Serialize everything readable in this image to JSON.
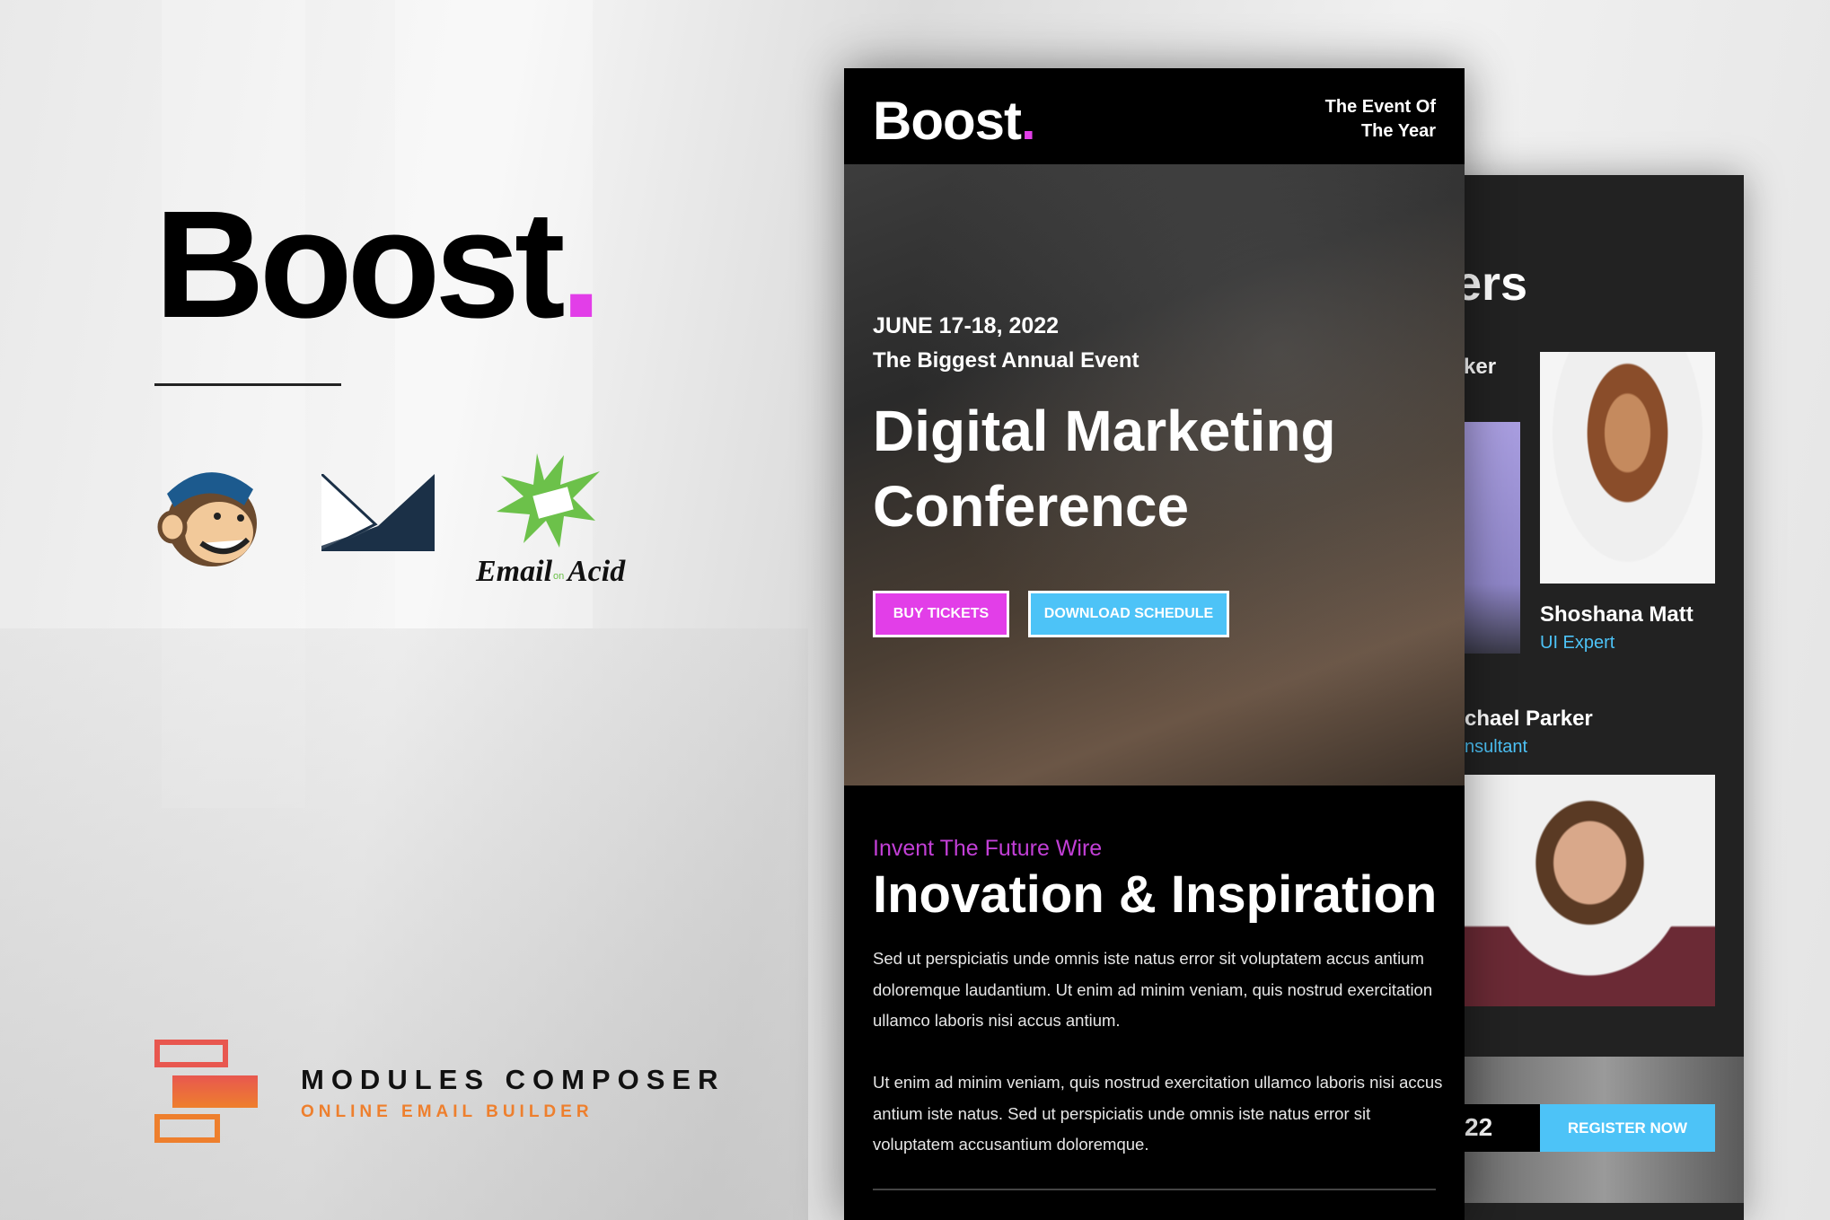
{
  "left": {
    "brand": {
      "name": "Boost",
      "dot": "."
    },
    "integrations": [
      {
        "icon": "mailchimp-logo-icon"
      },
      {
        "icon": "campaign-monitor-logo-icon"
      },
      {
        "icon": "email-on-acid-logo-icon",
        "wordmark": "Email on Acid"
      }
    ],
    "modules_composer": {
      "title": "MODULES COMPOSER",
      "subtitle": "ONLINE EMAIL BUILDER"
    }
  },
  "front_email": {
    "header": {
      "logo": "Boost",
      "logo_dot": ".",
      "tagline_line1": "The Event Of",
      "tagline_line2": "The Year"
    },
    "hero": {
      "date": "JUNE 17-18, 2022",
      "subtitle": "The Biggest Annual Event",
      "title_line1": "Digital Marketing",
      "title_line2": "Conference",
      "buy_tickets": "BUY TICKETS",
      "download_schedule": "DOWNLOAD SCHEDULE"
    },
    "intro": {
      "kicker": "Invent The Future Wire",
      "heading": "Inovation & Inspiration",
      "para1": "Sed ut perspiciatis unde omnis iste natus error sit voluptatem accus antium doloremque laudantium. Ut enim ad minim veniam, quis nostrud exercitation ullamco laboris nisi accus antium.",
      "para2": "Ut enim ad minim veniam, quis nostrud exercitation ullamco laboris nisi accus antium iste natus. Sed ut perspiciatis unde omnis iste natus error sit voluptatem accusantium doloremque."
    }
  },
  "back_email": {
    "section_title_partial": "ers",
    "section_sub_partial": "ker",
    "speakers": [
      {
        "name": "Shoshana Matt",
        "role": "UI Expert"
      },
      {
        "name": "chael Parker",
        "role": "nsultant"
      }
    ],
    "date_partial": "22",
    "register": "REGISTER NOW"
  },
  "colors": {
    "accent_pink": "#e23ee8",
    "accent_blue": "#4dc3f7",
    "orange": "#ee7f2d",
    "coral": "#e8574f"
  }
}
